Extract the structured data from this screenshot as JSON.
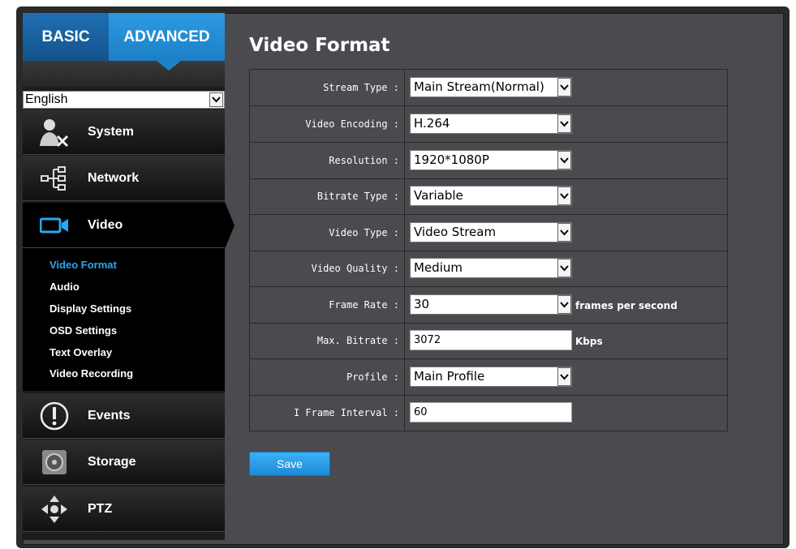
{
  "tabs": {
    "basic": "BASIC",
    "advanced": "ADVANCED"
  },
  "language": {
    "value": "English"
  },
  "nav": {
    "items": [
      {
        "label": "System",
        "icon": "system-tools-icon"
      },
      {
        "label": "Network",
        "icon": "network-tree-icon"
      },
      {
        "label": "Video",
        "icon": "video-camera-icon"
      },
      {
        "label": "Events",
        "icon": "alert-icon"
      },
      {
        "label": "Storage",
        "icon": "storage-disk-icon"
      },
      {
        "label": "PTZ",
        "icon": "ptz-arrows-icon"
      }
    ],
    "sub": [
      "Video Format",
      "Audio",
      "Display Settings",
      "OSD Settings",
      "Text Overlay",
      "Video Recording"
    ]
  },
  "page": {
    "title": "Video Format"
  },
  "form": {
    "stream_type": {
      "label": "Stream Type :",
      "value": "Main Stream(Normal)"
    },
    "video_encoding": {
      "label": "Video Encoding :",
      "value": "H.264"
    },
    "resolution": {
      "label": "Resolution :",
      "value": "1920*1080P"
    },
    "bitrate_type": {
      "label": "Bitrate Type :",
      "value": "Variable"
    },
    "video_type": {
      "label": "Video Type :",
      "value": "Video Stream"
    },
    "video_quality": {
      "label": "Video Quality :",
      "value": "Medium"
    },
    "frame_rate": {
      "label": "Frame Rate :",
      "value": "30",
      "unit": "frames per second"
    },
    "max_bitrate": {
      "label": "Max. Bitrate :",
      "value": "3072",
      "unit": "Kbps"
    },
    "profile": {
      "label": "Profile :",
      "value": "Main Profile"
    },
    "i_frame_interval": {
      "label": "I Frame Interval :",
      "value": "60"
    }
  },
  "actions": {
    "save": "Save"
  },
  "colors": {
    "accent": "#2aa7f0",
    "panel": "#4a4a4f",
    "sidebar": "#1c1c1c"
  }
}
